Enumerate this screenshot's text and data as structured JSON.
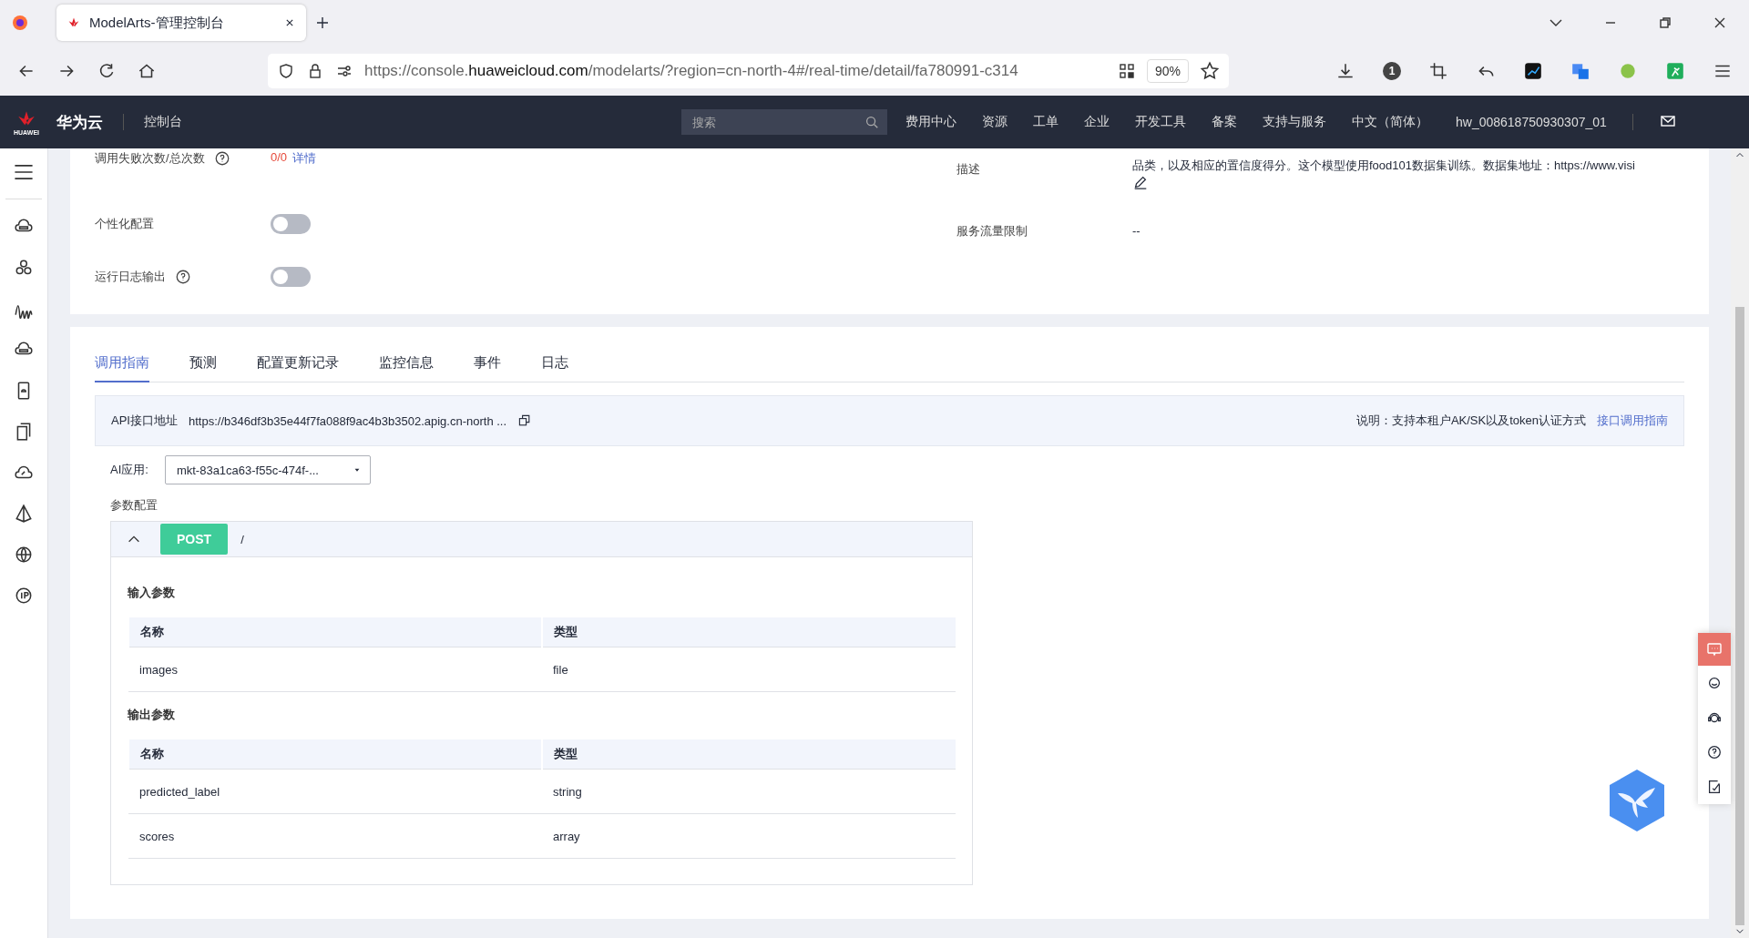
{
  "browser": {
    "tab_title": "ModelArts-管理控制台",
    "url_host_prefix": "https://console.",
    "url_domain": "huaweicloud.com",
    "url_path": "/modelarts/?region=cn-north-4#/real-time/detail/fa780991-c314",
    "zoom": "90%",
    "badge": "1"
  },
  "topnav": {
    "brand": "华为云",
    "logo_text": "HUAWEI",
    "console": "控制台",
    "search": {
      "placeholder": "搜索"
    },
    "links": [
      "费用中心",
      "资源",
      "工单",
      "企业",
      "开发工具",
      "备案",
      "支持与服务",
      "中文（简体）"
    ],
    "user": "hw_008618750930307_01"
  },
  "details": {
    "left": [
      {
        "kind": "stat",
        "label": "调用失败次数/总次数",
        "help": true,
        "value": "0/0",
        "link": "详情"
      },
      {
        "kind": "toggle",
        "label": "个性化配置",
        "help": false,
        "on": false
      },
      {
        "kind": "toggle",
        "label": "运行日志输出",
        "help": true,
        "on": false
      }
    ],
    "right": [
      {
        "label": "描述",
        "value": "品类，以及相应的置信度得分。这个模型使用food101数据集训练。数据集地址：https://www.visi",
        "editable": true
      },
      {
        "label": "服务流量限制",
        "value": "--",
        "editable": false
      }
    ]
  },
  "tabs": [
    {
      "label": "调用指南",
      "selected": true
    },
    {
      "label": "预测",
      "selected": false
    },
    {
      "label": "配置更新记录",
      "selected": false
    },
    {
      "label": "监控信息",
      "selected": false
    },
    {
      "label": "事件",
      "selected": false
    },
    {
      "label": "日志",
      "selected": false
    }
  ],
  "api": {
    "label": "API接口地址",
    "url": "https://b346df3b35e44f7fa088f9ac4b3b3502.apig.cn-north ...",
    "note": "说明：支持本租户AK/SK以及token认证方式",
    "guide_link": "接口调用指南"
  },
  "app": {
    "label": "AI应用:",
    "value": "mkt-83a1ca63-f55c-474f-..."
  },
  "params": {
    "title": "参数配置",
    "expanded": true,
    "method": "POST",
    "path": "/",
    "sections": [
      {
        "title": "输入参数",
        "columns": [
          "名称",
          "类型"
        ],
        "rows": [
          [
            "images",
            "file"
          ]
        ]
      },
      {
        "title": "输出参数",
        "columns": [
          "名称",
          "类型"
        ],
        "rows": [
          [
            "predicted_label",
            "string"
          ],
          [
            "scores",
            "array"
          ]
        ]
      }
    ]
  }
}
